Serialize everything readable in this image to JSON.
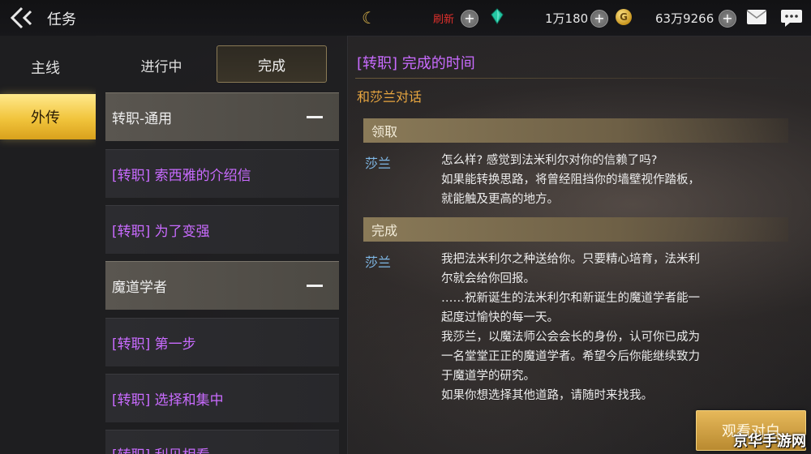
{
  "header": {
    "title": "任务",
    "refresh_label": "刷新",
    "energy_value": "1万180",
    "gold_value": "63万9266",
    "plus_symbol": "+",
    "icons": [
      "back-icon",
      "crescent-currency-icon",
      "gem-icon",
      "gold-coin-icon",
      "mail-icon",
      "chat-icon"
    ]
  },
  "categories": {
    "main_label": "主线",
    "side_label": "外传"
  },
  "tabs": {
    "in_progress": "进行中",
    "done": "完成"
  },
  "quest_list": [
    {
      "label": "转职-通用",
      "type": "group"
    },
    {
      "label": "[转职] 索西雅的介绍信",
      "type": "quest"
    },
    {
      "label": "[转职] 为了变强",
      "type": "quest"
    },
    {
      "label": "魔道学者",
      "type": "group"
    },
    {
      "label": "[转职] 第一步",
      "type": "quest"
    },
    {
      "label": "[转职] 选择和集中",
      "type": "quest"
    },
    {
      "label": "[转职] 利贝相看",
      "type": "quest"
    }
  ],
  "detail": {
    "title": "[转职] 完成的时间",
    "subtitle": "和莎兰对话",
    "receive_label": "领取",
    "receive_speaker": "莎兰",
    "receive_lines": [
      "怎么样? 感觉到法米利尔对你的信赖了吗?",
      "如果能转换思路，将曾经阻挡你的墙壁视作踏板，",
      "就能触及更高的地方。"
    ],
    "complete_label": "完成",
    "complete_speaker": "莎兰",
    "complete_lines": [
      "我把法米利尔之种送给你。只要精心培育，法米利",
      "尔就会给你回报。",
      "……祝新诞生的法米利尔和新诞生的魔道学者能一",
      "起度过愉快的每一天。",
      "我莎兰，以魔法师公会会长的身份，认可你已成为",
      "一名堂堂正正的魔道学者。希望今后你能继续致力",
      "于魔道学的研究。",
      "如果你想选择其他道路，请随时来找我。"
    ],
    "watch_button": "观看对白"
  },
  "watermark": "京华手游网",
  "colors": {
    "quest_purple": "#c96bff",
    "subtitle_orange": "#e8a640",
    "speaker_blue": "#7fb8e6",
    "gold_accent": "#f1c43c",
    "refresh_red": "#e0302b"
  }
}
